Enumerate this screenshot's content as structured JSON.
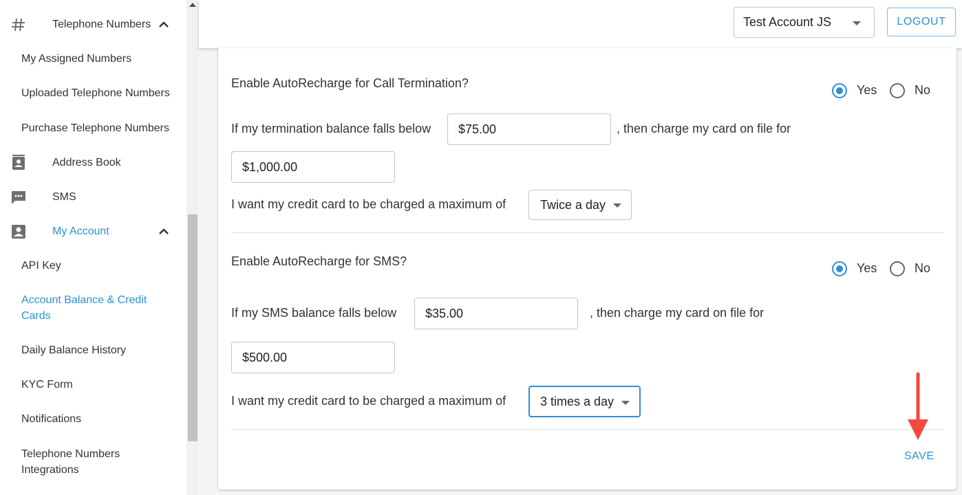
{
  "sidebar": {
    "groups": {
      "telephone_numbers": "Telephone Numbers",
      "address_book": "Address Book",
      "sms": "SMS",
      "my_account": "My Account"
    },
    "telephone_items": [
      "My Assigned Numbers",
      "Uploaded Telephone Numbers",
      "Purchase Telephone Numbers"
    ],
    "account_items": [
      "API Key",
      "Account Balance & Credit Cards",
      "Daily Balance History",
      "KYC Form",
      "Notifications",
      "Telephone Numbers Integrations"
    ],
    "active_item": "Account Balance & Credit Cards"
  },
  "header": {
    "account_selected": "Test Account JS",
    "logout_label": "LOGOUT"
  },
  "termination": {
    "question": "Enable AutoRecharge for Call Termination?",
    "yes_label": "Yes",
    "no_label": "No",
    "selected": "Yes",
    "below_prefix": "If my termination balance falls below",
    "threshold": "$75.00",
    "charge_suffix": ", then charge my card on file for",
    "amount": "$1,000.00",
    "max_label": "I want my credit card to be charged a maximum of",
    "frequency": "Twice a day"
  },
  "sms": {
    "question": "Enable AutoRecharge for SMS?",
    "yes_label": "Yes",
    "no_label": "No",
    "selected": "Yes",
    "below_prefix": "If my SMS balance falls below",
    "threshold": "$35.00",
    "charge_suffix": ", then charge my card on file for",
    "amount": "$500.00",
    "max_label": "I want my credit card to be charged a maximum of",
    "frequency": "3 times a day"
  },
  "actions": {
    "save_label": "SAVE"
  },
  "colors": {
    "accent": "#2d8fd5",
    "arrow": "#f44842"
  }
}
